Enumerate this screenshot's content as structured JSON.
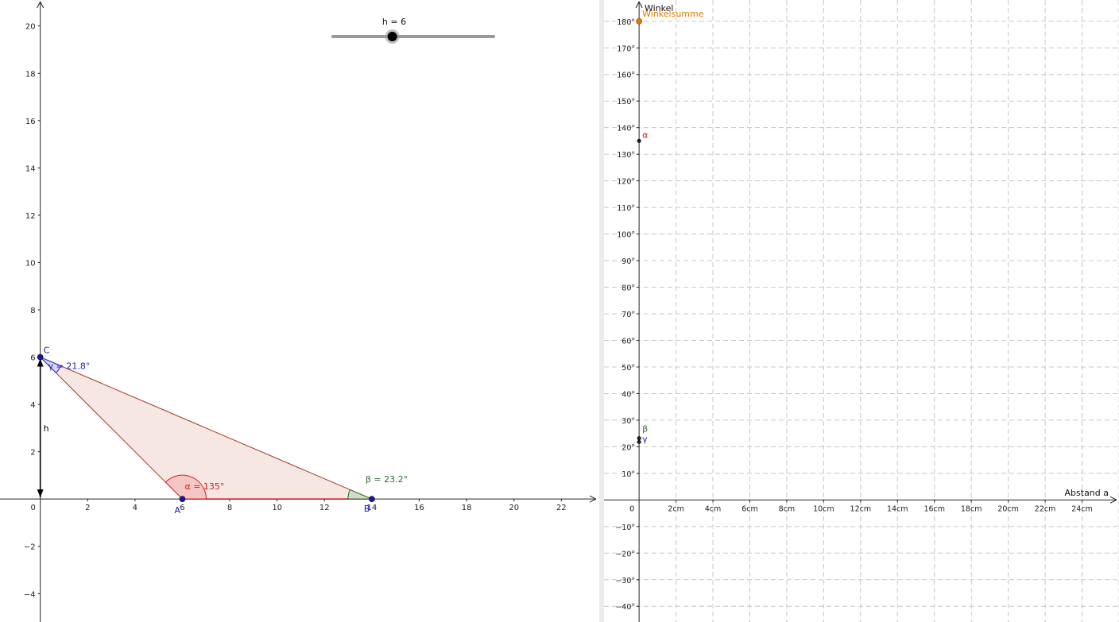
{
  "slider": {
    "label": "h = 6",
    "value": 6,
    "min": 0,
    "max": 20
  },
  "left_view": {
    "x_range": [
      -1.7,
      23.6
    ],
    "y_range": [
      -5.2,
      21.1
    ],
    "x_ticks": [
      0,
      2,
      4,
      6,
      8,
      10,
      12,
      14,
      16,
      18,
      20,
      22
    ],
    "y_ticks": [
      -4,
      -2,
      2,
      4,
      6,
      8,
      10,
      12,
      14,
      16,
      18,
      20
    ],
    "tick_labels": {
      "x": [
        "0",
        "2",
        "4",
        "6",
        "8",
        "10",
        "12",
        "14",
        "16",
        "18",
        "20",
        "22"
      ],
      "y": [
        "−4",
        "−2",
        "2",
        "4",
        "6",
        "8",
        "10",
        "12",
        "14",
        "16",
        "18",
        "20"
      ]
    },
    "points": [
      {
        "name": "A",
        "x": 6,
        "y": 0,
        "label": "A"
      },
      {
        "name": "B",
        "x": 14,
        "y": 0,
        "label": "B"
      },
      {
        "name": "C",
        "x": 0,
        "y": 6,
        "label": "C"
      }
    ],
    "h_label": "h",
    "angle_labels": {
      "alpha": "α = 135°",
      "beta": "β = 23.2°",
      "gamma": "γ = 21.8°"
    },
    "colors": {
      "triangle_fill": "#f4e3dd",
      "triangle_stroke": "#a0341a",
      "alpha": "#d31f1f",
      "beta": "#2d6e2d",
      "gamma": "#2020c8",
      "point": "#1414b4"
    }
  },
  "right_view": {
    "x_axis_label": "Abstand a",
    "y_axis_label": "Winkel",
    "x_range": [
      -1.9,
      26.0
    ],
    "y_range": [
      -45.9,
      188.0
    ],
    "x_ticks": [
      2,
      4,
      6,
      8,
      10,
      12,
      14,
      16,
      18,
      20,
      22,
      24
    ],
    "y_ticks": [
      -40,
      -30,
      -20,
      -10,
      10,
      20,
      30,
      40,
      50,
      60,
      70,
      80,
      90,
      100,
      110,
      120,
      130,
      140,
      150,
      160,
      170,
      180
    ],
    "tick_labels": {
      "origin": "0",
      "x": [
        "2cm",
        "4cm",
        "6cm",
        "8cm",
        "10cm",
        "12cm",
        "14cm",
        "16cm",
        "18cm",
        "20cm",
        "22cm",
        "24cm"
      ],
      "y": [
        "−40°",
        "−30°",
        "−20°",
        "−10°",
        "10°",
        "20°",
        "30°",
        "40°",
        "50°",
        "60°",
        "70°",
        "80°",
        "90°",
        "100°",
        "110°",
        "120°",
        "130°",
        "140°",
        "150°",
        "160°",
        "170°",
        "180°"
      ]
    },
    "grid": true,
    "points": [
      {
        "name": "winkelsumme",
        "x": 0,
        "y": 180,
        "label": "Winkelsumme",
        "color": "#e07b00"
      },
      {
        "name": "alpha",
        "x": 0,
        "y": 135,
        "label": "α",
        "color": "#d31f1f"
      },
      {
        "name": "beta",
        "x": 0,
        "y": 23.2,
        "label": "β",
        "color": "#2d6e2d"
      },
      {
        "name": "gamma",
        "x": 0,
        "y": 21.8,
        "label": "γ",
        "color": "#2020c8"
      }
    ]
  }
}
